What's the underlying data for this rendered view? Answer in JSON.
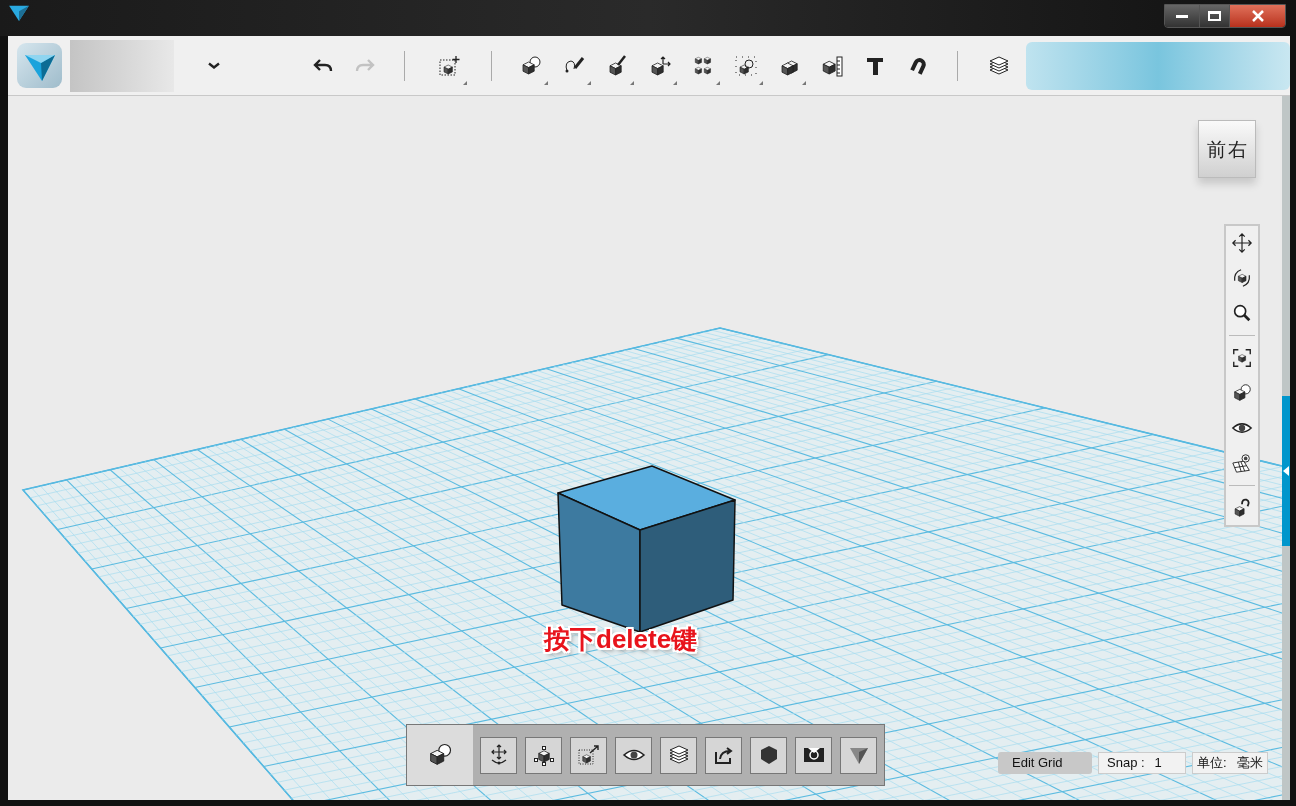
{
  "history": [
    {
      "kind": "undo",
      "disabled": false
    },
    {
      "kind": "redo",
      "disabled": true
    }
  ],
  "view_cube": {
    "faces": [
      "前",
      "右"
    ]
  },
  "annotation": "按下delete键",
  "bottom_toolbar": [
    {
      "kind": "mode",
      "selected": true
    },
    {
      "kind": "tool",
      "selected": false
    }
  ],
  "status_bar": {
    "edit_grid": "Edit Grid",
    "snap": {
      "label": "Snap :",
      "value": "1"
    },
    "units": {
      "label": "单位:",
      "value": "毫米"
    }
  }
}
